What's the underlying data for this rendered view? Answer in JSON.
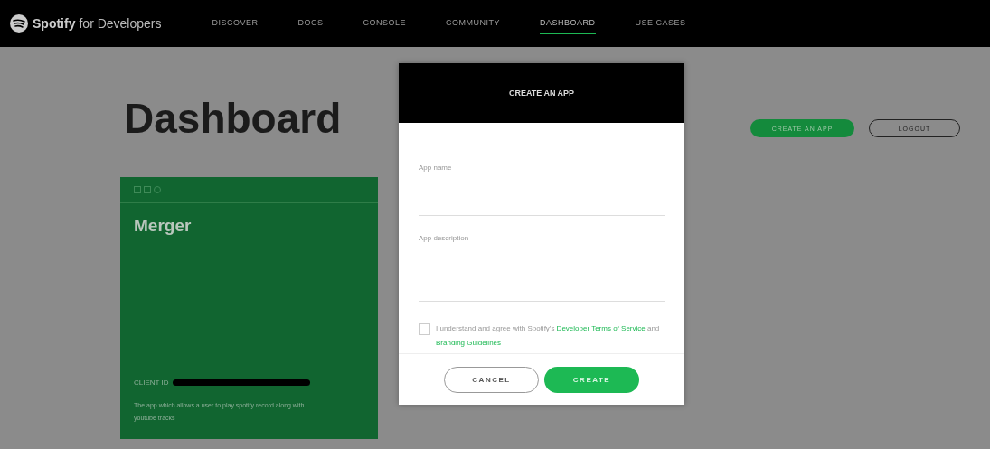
{
  "nav": {
    "brand": "Spotify",
    "brand_suffix": "for Developers",
    "items": [
      {
        "label": "DISCOVER",
        "selected": false
      },
      {
        "label": "DOCS",
        "selected": false
      },
      {
        "label": "CONSOLE",
        "selected": false
      },
      {
        "label": "COMMUNITY",
        "selected": false
      },
      {
        "label": "DASHBOARD",
        "selected": true
      },
      {
        "label": "USE CASES",
        "selected": false
      }
    ]
  },
  "page": {
    "title": "Dashboard",
    "create_button": "CREATE AN APP",
    "logout_button": "LOGOUT"
  },
  "app_card": {
    "name": "Merger",
    "client_id_label": "CLIENT ID",
    "description": "The app which allows a user to play spotify record along with youtube tracks"
  },
  "modal": {
    "title": "CREATE AN APP",
    "fields": [
      {
        "kind": "input",
        "placeholder": "App name"
      },
      {
        "kind": "textarea",
        "placeholder": "App description"
      }
    ],
    "agreement": {
      "checked": false,
      "text": "I understand and agree with Spotify's ",
      "link1": "Developer Terms of Service",
      "middle": " and ",
      "link2": "Branding Guidelines"
    },
    "buttons": [
      {
        "kind": "secondary",
        "label": "CANCEL"
      },
      {
        "kind": "primary",
        "label": "CREATE"
      }
    ]
  }
}
